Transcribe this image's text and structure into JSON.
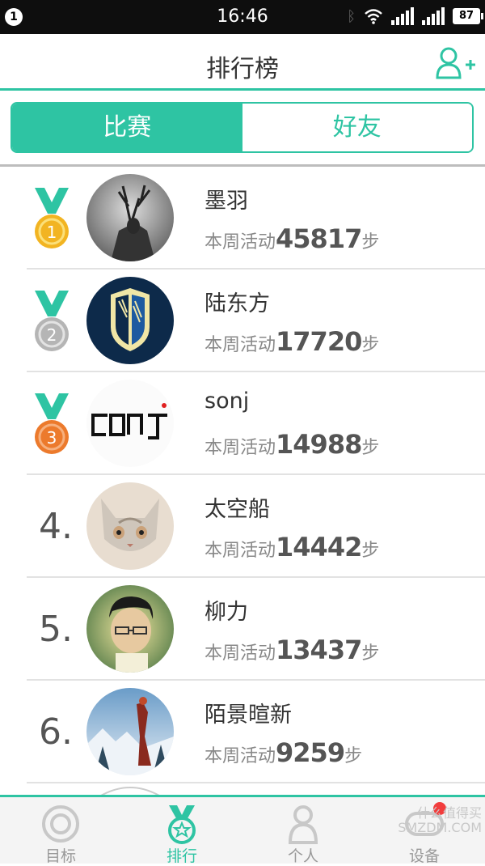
{
  "status_bar": {
    "notification_count": "1",
    "time": "16:46",
    "battery": "87",
    "sim_label": "2"
  },
  "header": {
    "title": "排行榜",
    "add_friend_icon": "add-user-icon"
  },
  "tabs": [
    {
      "label": "比赛",
      "active": true
    },
    {
      "label": "好友",
      "active": false
    }
  ],
  "steps_prefix": "本周活动",
  "steps_suffix": "步",
  "entries": [
    {
      "rank": "1",
      "medal": "gold",
      "name": "墨羽",
      "steps": "45817"
    },
    {
      "rank": "2",
      "medal": "silver",
      "name": "陆东方",
      "steps": "17720"
    },
    {
      "rank": "3",
      "medal": "bronze",
      "name": "sonj",
      "steps": "14988"
    },
    {
      "rank": "4.",
      "medal": null,
      "name": "太空船",
      "steps": "14442"
    },
    {
      "rank": "5.",
      "medal": null,
      "name": "柳力",
      "steps": "13437"
    },
    {
      "rank": "6.",
      "medal": null,
      "name": "陌景暄新",
      "steps": "9259"
    }
  ],
  "bottom_tabs": [
    {
      "label": "目标",
      "icon": "target-icon",
      "active": false
    },
    {
      "label": "排行",
      "icon": "medal-icon",
      "active": true
    },
    {
      "label": "个人",
      "icon": "person-icon",
      "active": false
    },
    {
      "label": "设备",
      "icon": "device-icon",
      "active": false
    }
  ],
  "watermark": {
    "line1": "什么值得买",
    "line2": "SMZDM.COM"
  },
  "colors": {
    "accent": "#2ec4a3",
    "gold": "#f2b422",
    "silver": "#b5b5b5",
    "bronze": "#ec7a2c",
    "badge": "#f23d3d"
  }
}
